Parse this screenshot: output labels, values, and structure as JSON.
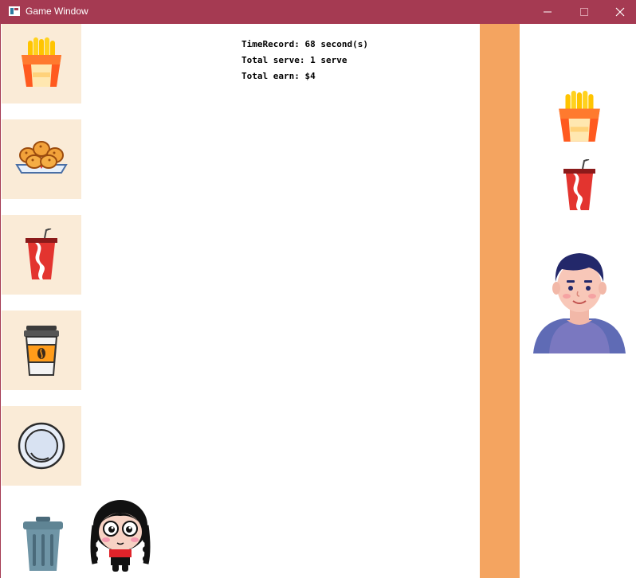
{
  "window": {
    "title": "Game Window",
    "colors": {
      "titlebar": "#a53a52",
      "slot_bg": "#faebd7",
      "counter": "#f4a460"
    }
  },
  "menu": {
    "items": [
      {
        "id": "fries",
        "icon": "fries-icon"
      },
      {
        "id": "nuggets",
        "icon": "nuggets-icon"
      },
      {
        "id": "soda",
        "icon": "soda-cup-icon"
      },
      {
        "id": "coffee",
        "icon": "coffee-cup-icon"
      },
      {
        "id": "plate",
        "icon": "plate-icon"
      }
    ],
    "trash_icon": "trash-can-icon"
  },
  "stats": {
    "time_record": "TimeRecord: 68 second(s)",
    "total_serve": "Total serve: 1 serve",
    "total_earn": "Total earn: $4"
  },
  "customer": {
    "order": [
      "fries",
      "soda"
    ],
    "avatar": "customer-avatar"
  },
  "player": {
    "avatar": "chef-girl-avatar"
  }
}
